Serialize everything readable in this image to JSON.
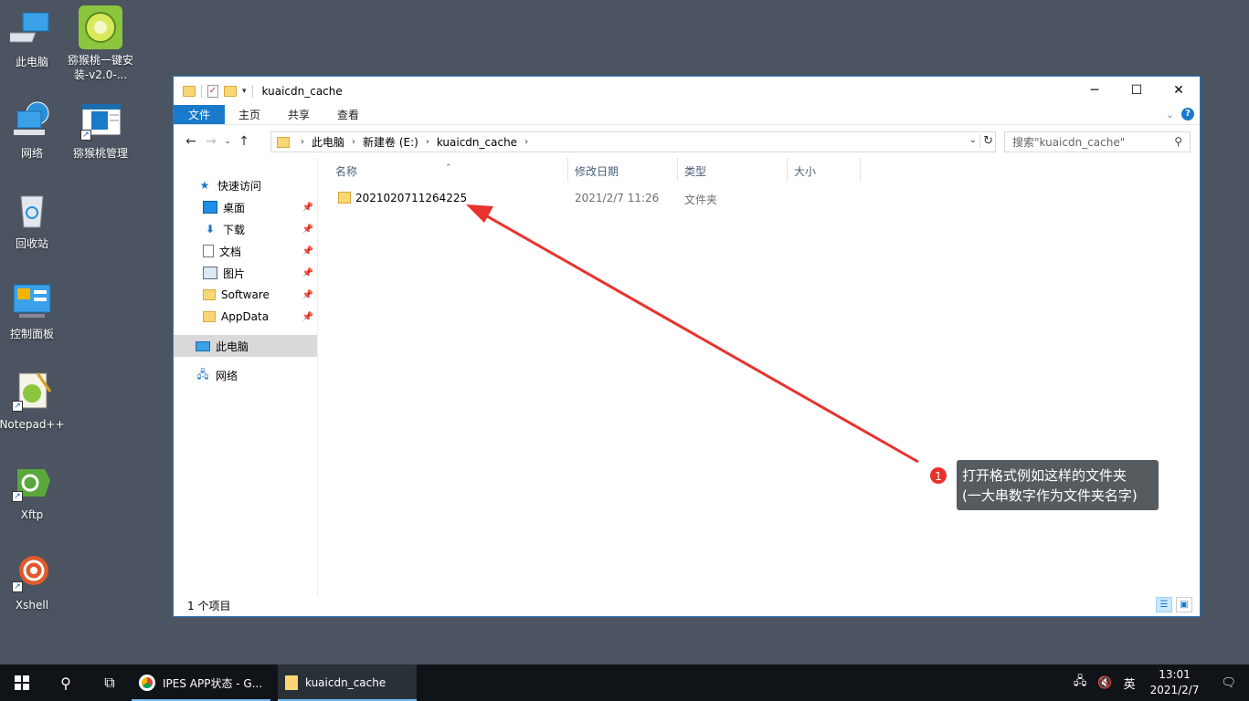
{
  "desktop": {
    "icons": [
      {
        "label": "此电脑"
      },
      {
        "label": "猕猴桃一键安装-v2.0-..."
      },
      {
        "label": "网络"
      },
      {
        "label": "猕猴桃管理"
      },
      {
        "label": "回收站"
      },
      {
        "label": "控制面板"
      },
      {
        "label": "Notepad++"
      },
      {
        "label": "Xftp"
      },
      {
        "label": "Xshell"
      }
    ]
  },
  "window": {
    "title": "kuaicdn_cache",
    "ribbon_tabs": [
      "文件",
      "主页",
      "共享",
      "查看"
    ],
    "breadcrumbs": [
      "此电脑",
      "新建卷 (E:)",
      "kuaicdn_cache"
    ],
    "search_placeholder": "搜索\"kuaicdn_cache\"",
    "nav": {
      "quick_access": "快速访问",
      "items": [
        "桌面",
        "下载",
        "文档",
        "图片",
        "Software",
        "AppData"
      ],
      "this_pc": "此电脑",
      "network": "网络"
    },
    "columns": [
      "名称",
      "修改日期",
      "类型",
      "大小"
    ],
    "files": [
      {
        "name": "2021020711264225",
        "date": "2021/2/7 11:26",
        "type": "文件夹",
        "size": ""
      }
    ],
    "status": "1 个项目"
  },
  "annotation": {
    "number": "1",
    "line1": "打开格式例如这样的文件夹",
    "line2": "(一大串数字作为文件夹名字)",
    "color": "#e8322d"
  },
  "taskbar": {
    "apps": [
      "IPES APP状态 - G...",
      "kuaicdn_cache"
    ],
    "ime": "英",
    "time": "13:01",
    "date": "2021/2/7"
  }
}
